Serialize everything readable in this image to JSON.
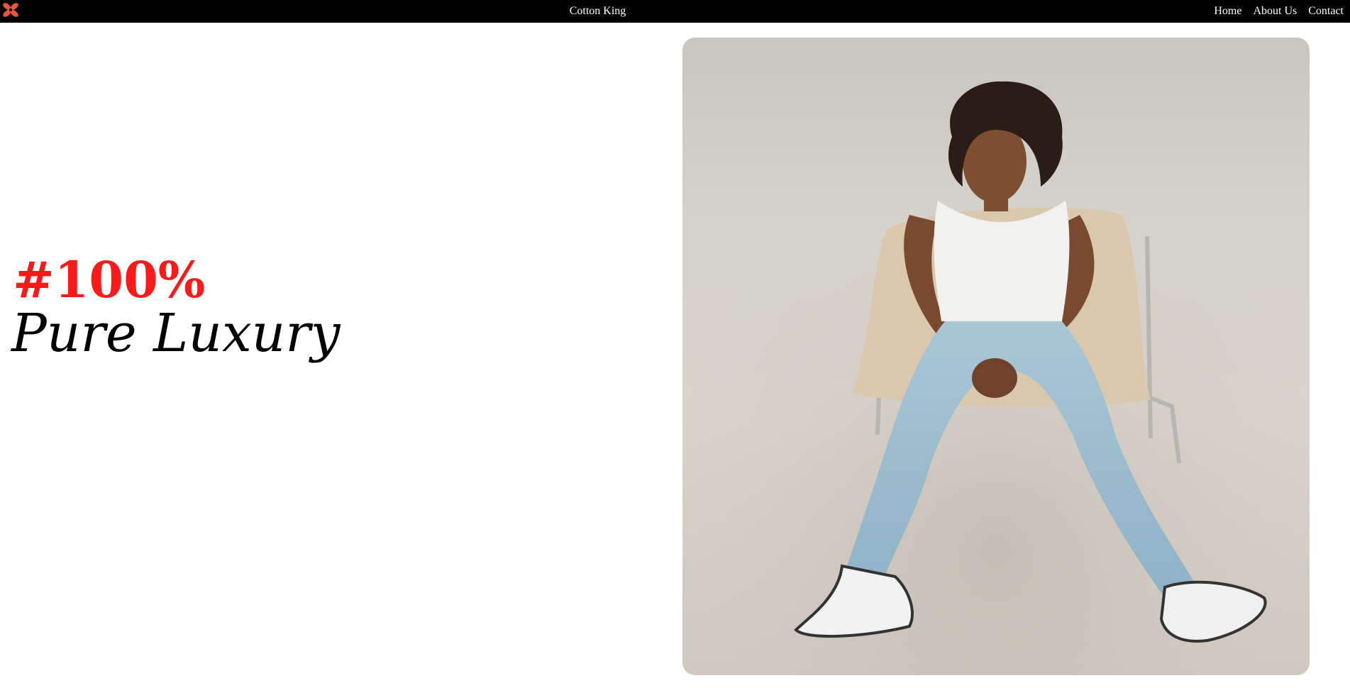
{
  "navbar": {
    "brand": "Cotton King",
    "logo_icon": "x-star-logo-icon",
    "links": [
      {
        "label": "Home"
      },
      {
        "label": "About Us"
      },
      {
        "label": "Contact"
      }
    ]
  },
  "hero": {
    "number_text": "#100%",
    "tagline": "Pure Luxury",
    "accent_color": "#ff1a1a",
    "image_subject": "model-photo"
  },
  "colors": {
    "navbar_bg": "#000000",
    "nav_text": "#ffffff",
    "page_bg": "#ffffff",
    "accent": "#ff1a1a",
    "logo": "#e8563f"
  }
}
